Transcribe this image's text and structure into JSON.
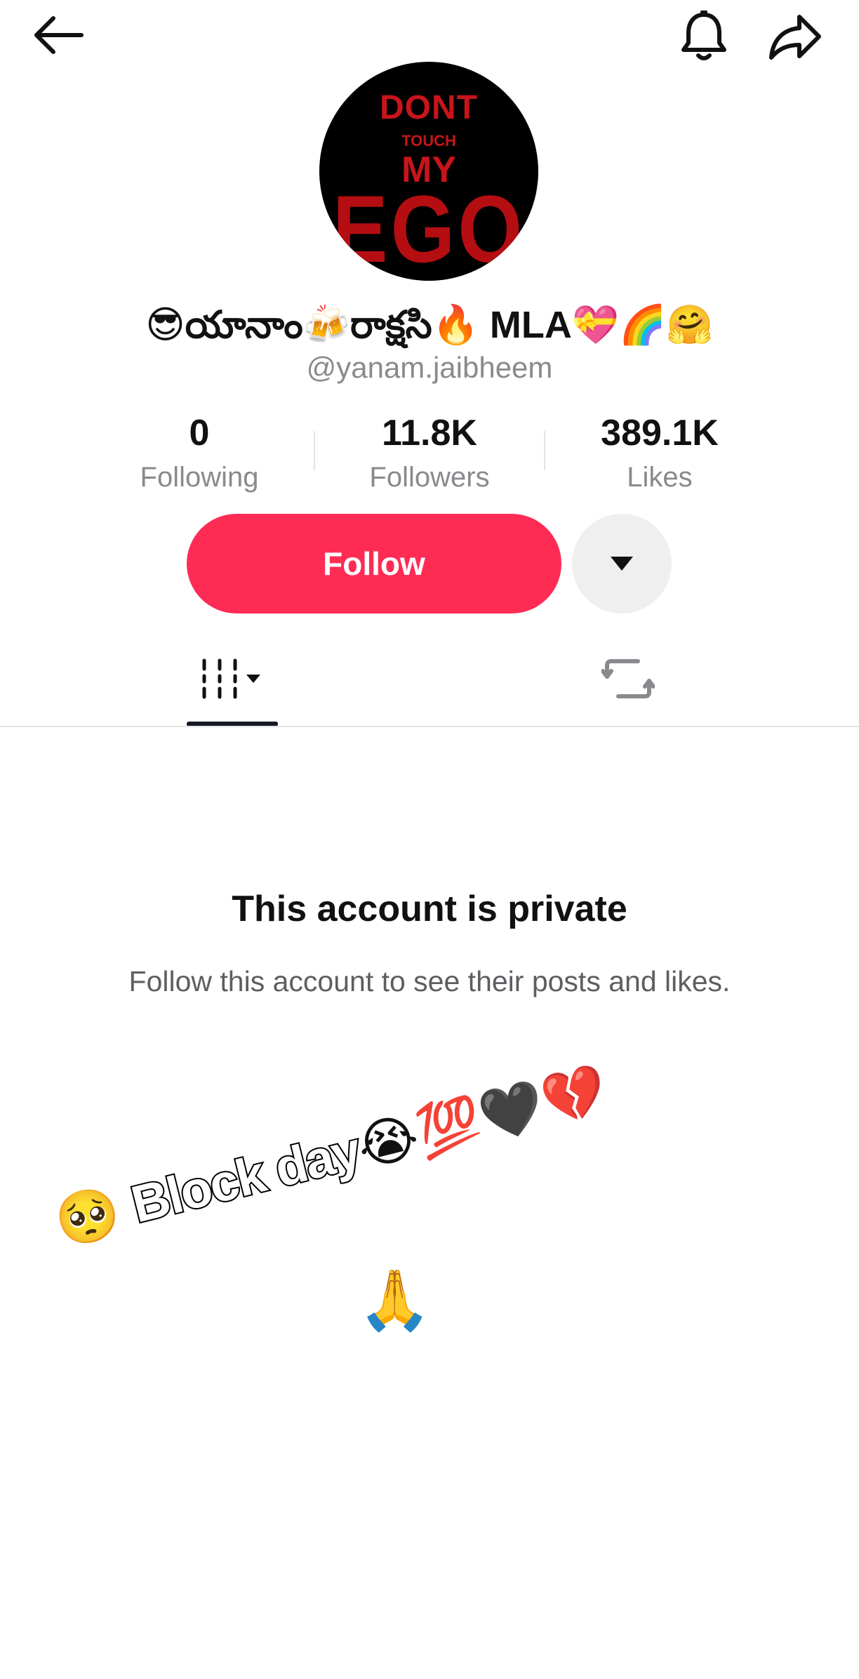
{
  "top_bar": {
    "back_icon": "arrow-left-icon",
    "bell_icon": "bell-icon",
    "share_icon": "share-arrow-icon"
  },
  "profile": {
    "avatar_text": {
      "line1": "DONT",
      "line2": "TOUCH",
      "line3": "MY",
      "line4": "EGO"
    },
    "display_name": "😎యానాం🍻రాక్షసి🔥 MLA💝🌈🤗",
    "handle": "@yanam.jaibheem"
  },
  "stats": {
    "following": {
      "value": "0",
      "label": "Following"
    },
    "followers": {
      "value": "11.8K",
      "label": "Followers"
    },
    "likes": {
      "value": "389.1K",
      "label": "Likes"
    }
  },
  "actions": {
    "follow_label": "Follow",
    "more_icon": "caret-down-icon"
  },
  "tabs": {
    "videos_icon": "grid-videos-icon",
    "reposts_icon": "repost-icon",
    "active": "videos"
  },
  "private_notice": {
    "title": "This account is private",
    "subtitle": "Follow this account to see their posts and likes."
  },
  "overlay": {
    "emoji_left": "🥺",
    "text": "Block day",
    "emoji_right": "😭💯🖤💔",
    "line2": "🙏"
  },
  "colors": {
    "accent": "#fe2c55",
    "secondary_text": "#8a8a8e",
    "avatar_red": "#c8141b"
  }
}
